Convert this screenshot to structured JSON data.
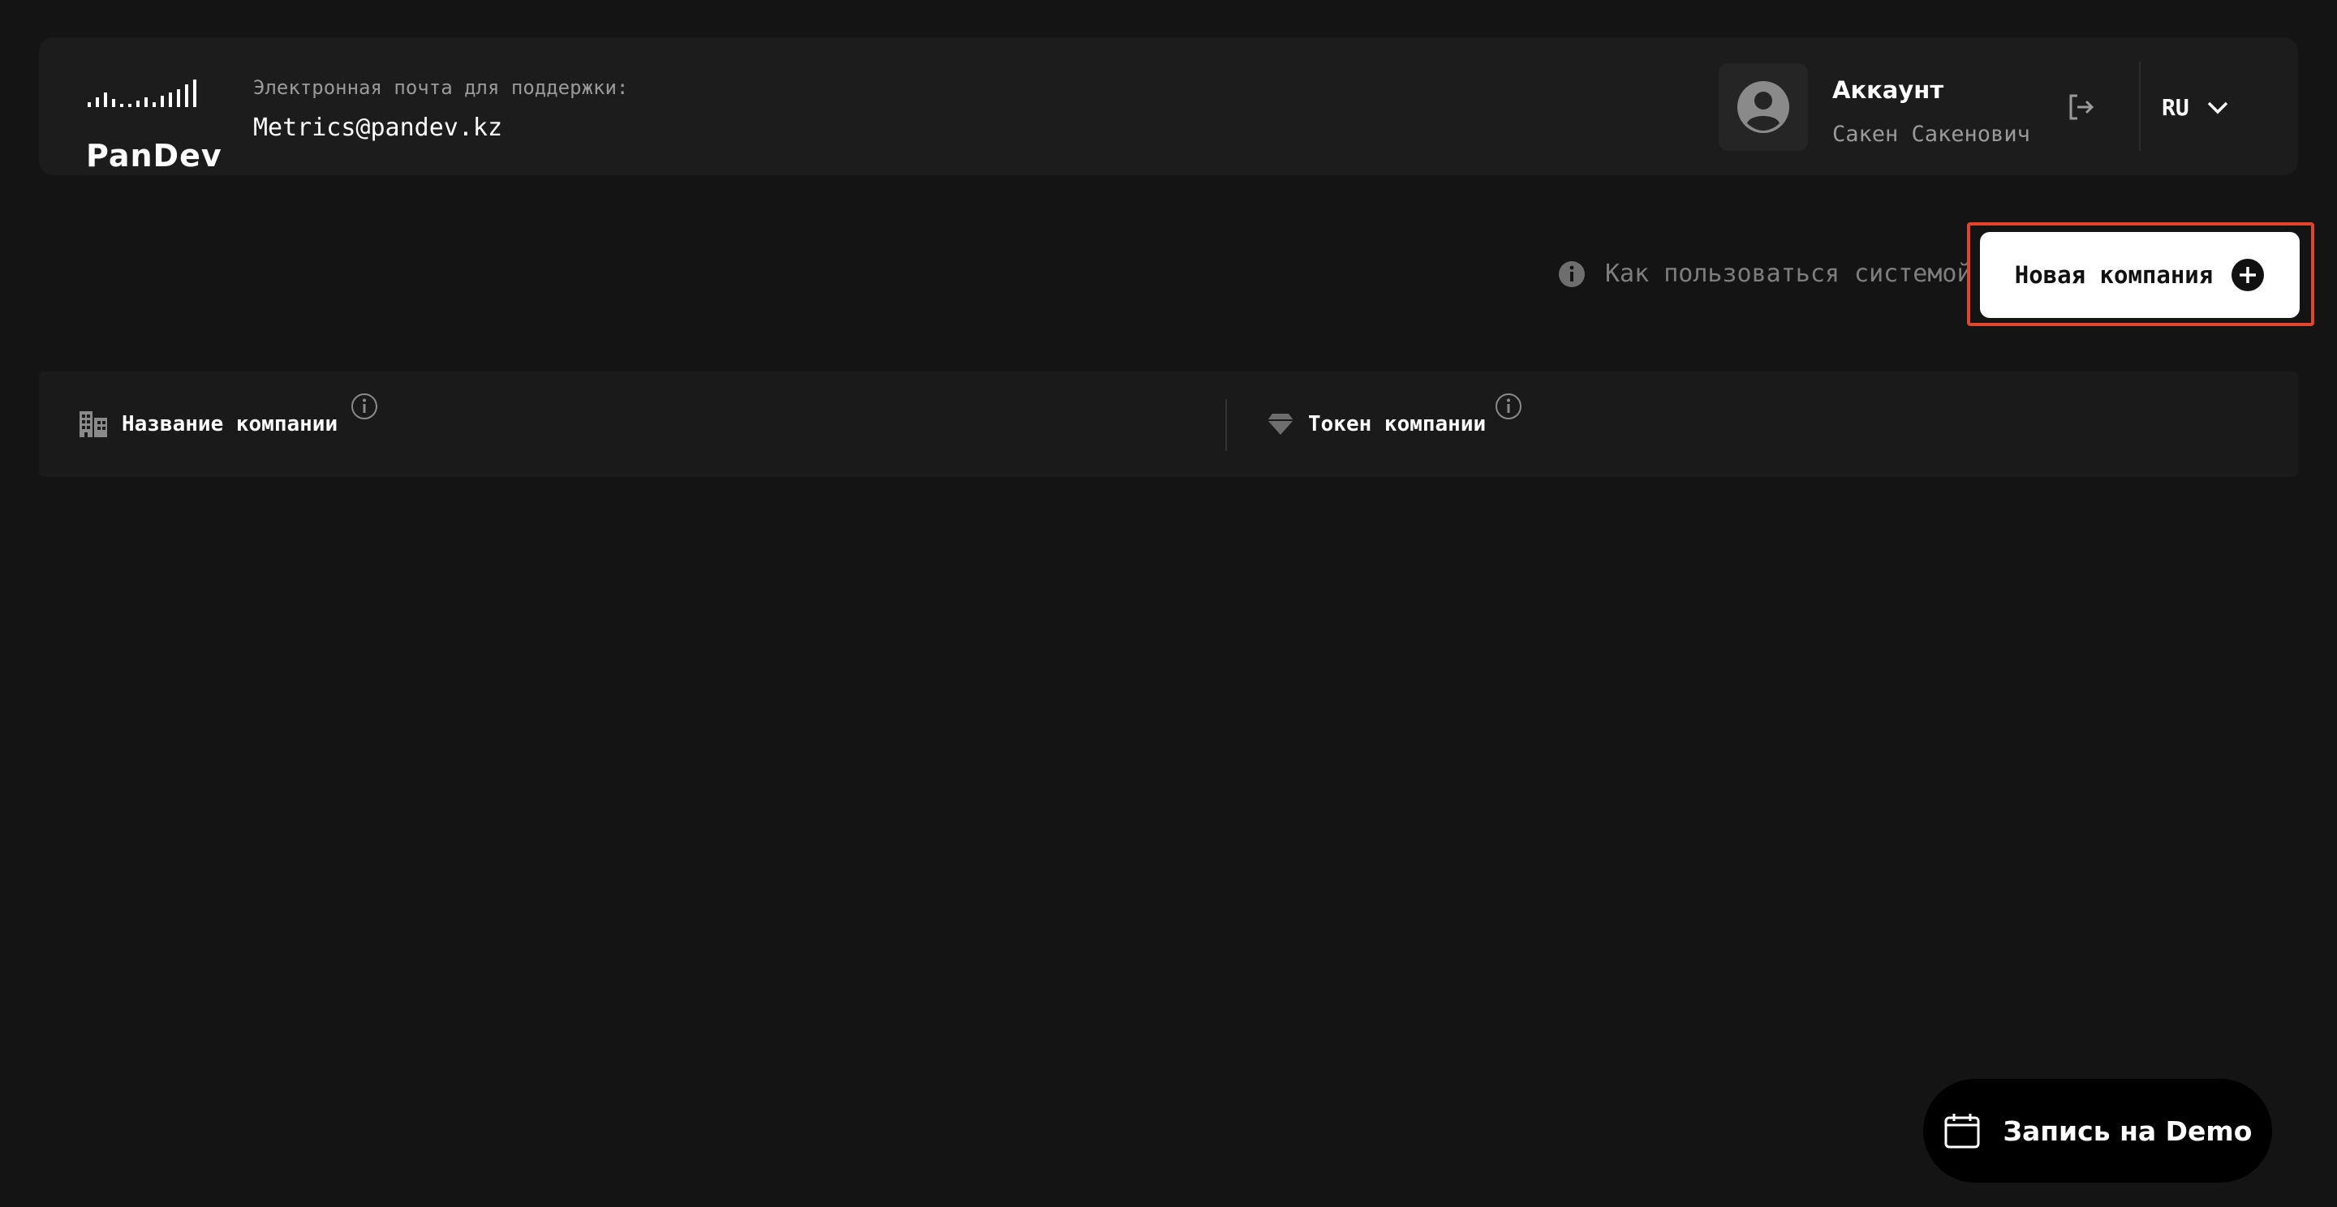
{
  "header": {
    "logo_text": "PanDev",
    "support_label": "Электронная почта для поддержки:",
    "support_email": "Metrics@pandev.kz",
    "account_title": "Аккаунт",
    "account_name": "Сакен Сакенович",
    "language": "RU"
  },
  "toolbar": {
    "help_text": "Как пользоваться системой",
    "new_company_label": "Новая компания"
  },
  "table": {
    "columns": [
      {
        "label": "Название компании",
        "icon": "building-icon"
      },
      {
        "label": "Токен компании",
        "icon": "diamond-icon"
      }
    ]
  },
  "demo_button": {
    "label": "Запись на Demo",
    "icon": "calendar-icon"
  },
  "colors": {
    "background": "#141414",
    "panel": "#1c1c1c",
    "accent_focus": "#e2452a",
    "muted_text": "#9a9a9a"
  }
}
